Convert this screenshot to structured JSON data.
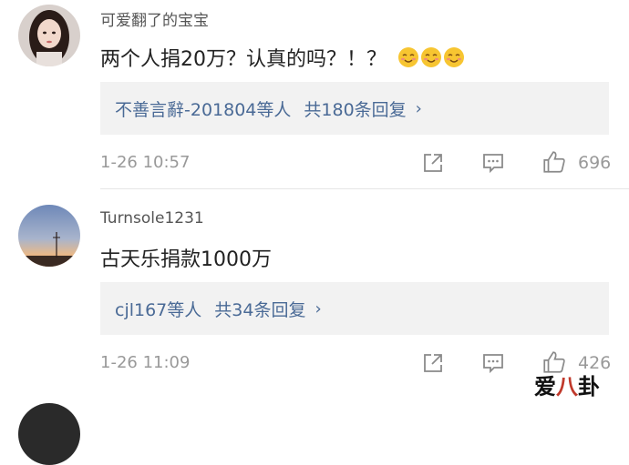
{
  "comments": [
    {
      "username": "可爱翻了的宝宝",
      "text": "两个人捐20万？认真的吗？！？",
      "emojis": [
        "smiling-face-icon",
        "smiling-face-icon",
        "smiling-face-icon"
      ],
      "reply_users": "不善言辭-201804等人",
      "reply_count": "共180条回复",
      "reply_chevron": "›",
      "time": "1-26 10:57",
      "likes": "696"
    },
    {
      "username": "Turnsole1231",
      "text": "古天乐捐款1000万",
      "reply_users": "cjl167等人",
      "reply_count": "共34条回复",
      "reply_chevron": "›",
      "time": "1-26 11:09",
      "likes": "426"
    }
  ],
  "watermark": {
    "part1": "爱",
    "part2": "八",
    "part3": "卦"
  },
  "colors": {
    "link": "#4a6a96",
    "meta": "#999999",
    "reply_bg": "#f2f2f2"
  }
}
